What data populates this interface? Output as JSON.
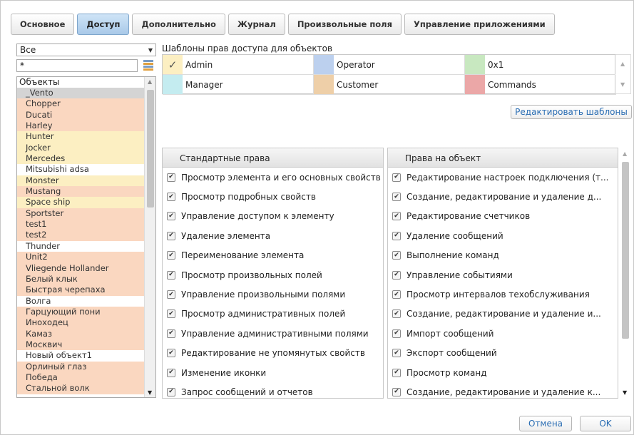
{
  "tabs": [
    {
      "label": "Основное"
    },
    {
      "label": "Доступ"
    },
    {
      "label": "Дополнительно"
    },
    {
      "label": "Журнал"
    },
    {
      "label": "Произвольные поля"
    },
    {
      "label": "Управление приложениями"
    }
  ],
  "active_tab_index": 1,
  "filter": {
    "selected": "Все"
  },
  "search": {
    "value": "*"
  },
  "objects": {
    "header": "Объекты",
    "items": [
      {
        "name": "_Vento",
        "color": "gray"
      },
      {
        "name": "Chopper",
        "color": "pink"
      },
      {
        "name": "Ducati",
        "color": "pink"
      },
      {
        "name": "Harley",
        "color": "pink"
      },
      {
        "name": "Hunter",
        "color": "yellow"
      },
      {
        "name": "Jocker",
        "color": "yellow"
      },
      {
        "name": "Mercedes",
        "color": "yellow"
      },
      {
        "name": "Mitsubishi adsa",
        "color": "white"
      },
      {
        "name": "Monster",
        "color": "yellow"
      },
      {
        "name": "Mustang",
        "color": "pink"
      },
      {
        "name": "Space ship",
        "color": "yellow"
      },
      {
        "name": "Sportster",
        "color": "pink"
      },
      {
        "name": "test1",
        "color": "pink"
      },
      {
        "name": "test2",
        "color": "pink"
      },
      {
        "name": "Thunder",
        "color": "white"
      },
      {
        "name": "Unit2",
        "color": "pink"
      },
      {
        "name": "Vliegende Hollander",
        "color": "pink"
      },
      {
        "name": "Белый клык",
        "color": "pink"
      },
      {
        "name": "Быстрая черепаха",
        "color": "pink"
      },
      {
        "name": "Волга",
        "color": "white"
      },
      {
        "name": "Гарцующий пони",
        "color": "pink"
      },
      {
        "name": "Иноходец",
        "color": "pink"
      },
      {
        "name": "Камаз",
        "color": "pink"
      },
      {
        "name": "Москвич",
        "color": "pink"
      },
      {
        "name": "Новый объект1",
        "color": "white"
      },
      {
        "name": "Орлиный глаз",
        "color": "pink"
      },
      {
        "name": "Победа",
        "color": "pink"
      },
      {
        "name": "Стальной волк",
        "color": "pink"
      }
    ]
  },
  "templates": {
    "title": "Шаблоны прав доступа для объектов",
    "items": [
      {
        "name": "Admin",
        "color": "#fcefc2",
        "checked": true
      },
      {
        "name": "Operator",
        "color": "#bcd0ee",
        "checked": false
      },
      {
        "name": "0x1",
        "color": "#c8e8c0",
        "checked": false
      },
      {
        "name": "Manager",
        "color": "#c4ecf0",
        "checked": false
      },
      {
        "name": "Customer",
        "color": "#eecfa8",
        "checked": false
      },
      {
        "name": "Commands",
        "color": "#eba7a7",
        "checked": false
      }
    ],
    "edit_button": "Редактировать шаблоны"
  },
  "standard_rights": {
    "header": "Стандартные права",
    "items": [
      "Просмотр элемента и его основных свойств",
      "Просмотр подробных свойств",
      "Управление доступом к элементу",
      "Удаление элемента",
      "Переименование элемента",
      "Просмотр произвольных полей",
      "Управление произвольными полями",
      "Просмотр административных полей",
      "Управление административными полями",
      "Редактирование не упомянутых свойств",
      "Изменение иконки",
      "Запрос сообщений и отчетов"
    ]
  },
  "object_rights": {
    "header": "Права на объект",
    "items": [
      "Редактирование настроек подключения (т...",
      "Создание, редактирование и удаление д...",
      "Редактирование счетчиков",
      "Удаление сообщений",
      "Выполнение команд",
      "Управление событиями",
      "Просмотр интервалов техобслуживания",
      "Создание, редактирование и удаление и...",
      "Импорт сообщений",
      "Экспорт сообщений",
      "Просмотр команд",
      "Создание, редактирование и удаление к..."
    ]
  },
  "footer": {
    "cancel_label": "Отмена",
    "ok_label": "OK"
  },
  "colors": {
    "pink": "#fad7c0",
    "yellow": "#fcefc2",
    "accent": "#2a6db3"
  }
}
